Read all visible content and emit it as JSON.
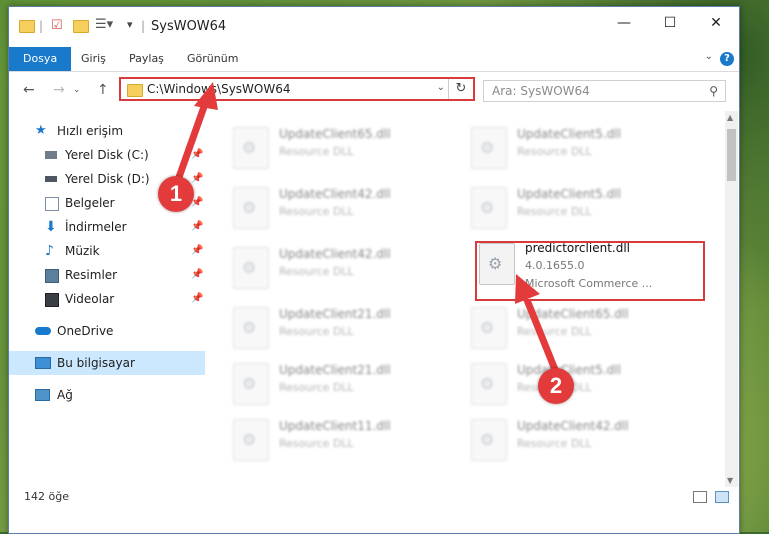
{
  "window": {
    "title": "SysWOW64",
    "controls": {
      "minimize": "—",
      "maximize": "☐",
      "close": "✕"
    }
  },
  "ribbon": {
    "tabs": [
      {
        "label": "Dosya",
        "active": true
      },
      {
        "label": "Giriş"
      },
      {
        "label": "Paylaş"
      },
      {
        "label": "Görünüm"
      }
    ],
    "help": "?"
  },
  "navigation": {
    "back": "←",
    "forward": "→",
    "up": "↑",
    "address": "C:\\Windows\\SysWOW64",
    "refresh": "↻",
    "search_placeholder": "Ara: SysWOW64"
  },
  "sidebar": {
    "items": [
      {
        "label": "Hızlı erişim",
        "icon": "star-icon"
      },
      {
        "label": "Yerel Disk (C:)",
        "icon": "drive-icon",
        "pinned": true
      },
      {
        "label": "Yerel Disk (D:)",
        "icon": "drive-icon",
        "pinned": true
      },
      {
        "label": "Belgeler",
        "icon": "documents-icon",
        "pinned": true
      },
      {
        "label": "İndirmeler",
        "icon": "download-icon",
        "pinned": true
      },
      {
        "label": "Müzik",
        "icon": "music-icon",
        "pinned": true
      },
      {
        "label": "Resimler",
        "icon": "pictures-icon",
        "pinned": true
      },
      {
        "label": "Videolar",
        "icon": "video-icon",
        "pinned": true
      },
      {
        "label": "OneDrive",
        "icon": "cloud-icon"
      },
      {
        "label": "Bu bilgisayar",
        "icon": "computer-icon",
        "selected": true
      },
      {
        "label": "Ağ",
        "icon": "network-icon"
      }
    ]
  },
  "files": {
    "left": [
      {
        "name": "UpdateClient65.dll",
        "desc": "Resource DLL"
      },
      {
        "name": "UpdateClient42.dll",
        "desc": "Resource DLL"
      },
      {
        "name": "UpdateClient42.dll",
        "desc": "Resource DLL"
      },
      {
        "name": "UpdateClient21.dll",
        "desc": "Resource DLL"
      },
      {
        "name": "UpdateClient21.dll",
        "desc": "Resource DLL"
      },
      {
        "name": "UpdateClient11.dll",
        "desc": "Resource DLL"
      }
    ],
    "right": [
      {
        "name": "UpdateClient5.dll",
        "desc": "Resource DLL"
      },
      {
        "name": "UpdateClient5.dll",
        "desc": "Resource DLL"
      },
      {
        "name": "predictorclient.dll",
        "desc": "4.0.1655.0",
        "desc2": "Microsoft Commerce ...",
        "highlight": true
      },
      {
        "name": "UpdateClient65.dll",
        "desc": "Resource DLL"
      },
      {
        "name": "UpdateClient5.dll",
        "desc": "Resource DLL"
      },
      {
        "name": "UpdateClient42.dll",
        "desc": "Resource DLL"
      }
    ]
  },
  "status": {
    "item_count": "142 öğe"
  },
  "annotations": {
    "step1": "1",
    "step2": "2"
  },
  "colors": {
    "accent": "#1979ca",
    "highlight": "#d83b3b",
    "selected": "#cce8ff"
  }
}
